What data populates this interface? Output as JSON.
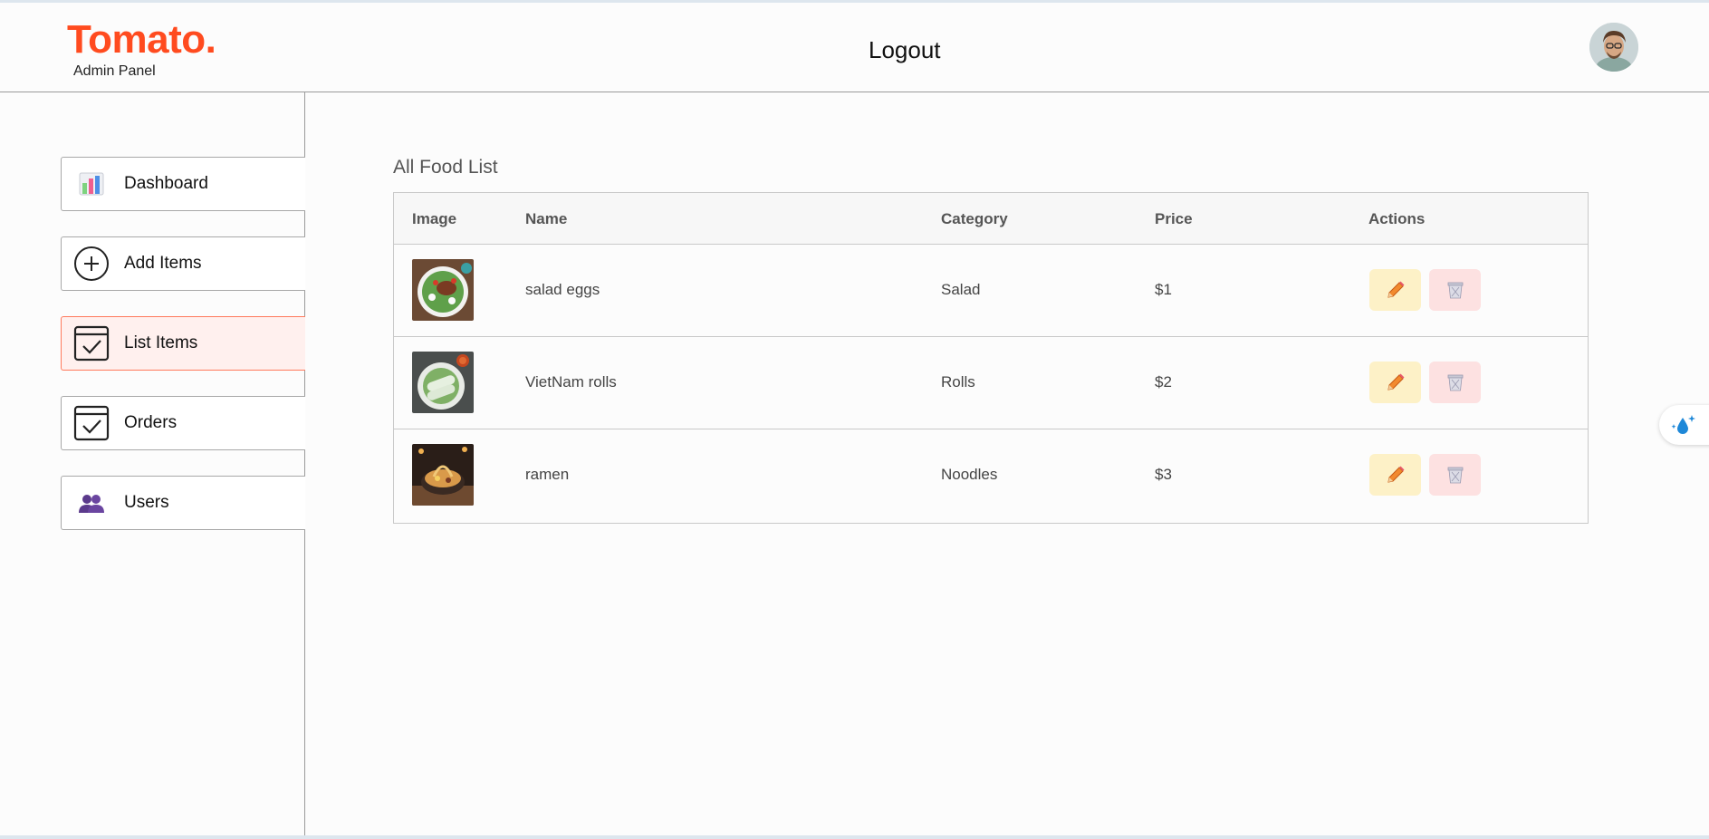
{
  "header": {
    "logo": "Tomato.",
    "subtitle": "Admin Panel",
    "logout_label": "Logout",
    "brand_color": "#ff4b1f"
  },
  "sidebar": {
    "items": [
      {
        "label": "Dashboard",
        "icon": "bar-chart-icon"
      },
      {
        "label": "Add Items",
        "icon": "plus-circle-icon"
      },
      {
        "label": "List Items",
        "icon": "calendar-check-icon",
        "active": true
      },
      {
        "label": "Orders",
        "icon": "calendar-check-icon"
      },
      {
        "label": "Users",
        "icon": "users-icon"
      }
    ]
  },
  "main": {
    "title": "All Food List",
    "columns": [
      "Image",
      "Name",
      "Category",
      "Price",
      "Actions"
    ],
    "rows": [
      {
        "name": "salad eggs",
        "category": "Salad",
        "price": "$1",
        "image": "salad-photo"
      },
      {
        "name": "VietNam rolls",
        "category": "Rolls",
        "price": "$2",
        "image": "rolls-photo"
      },
      {
        "name": "ramen",
        "category": "Noodles",
        "price": "$3",
        "image": "ramen-photo"
      }
    ]
  },
  "colors": {
    "edit_bg": "#fdf1c7",
    "delete_bg": "#fde1e1",
    "active_nav_bg": "#fff0ee",
    "active_nav_border": "#ff7a5c"
  }
}
